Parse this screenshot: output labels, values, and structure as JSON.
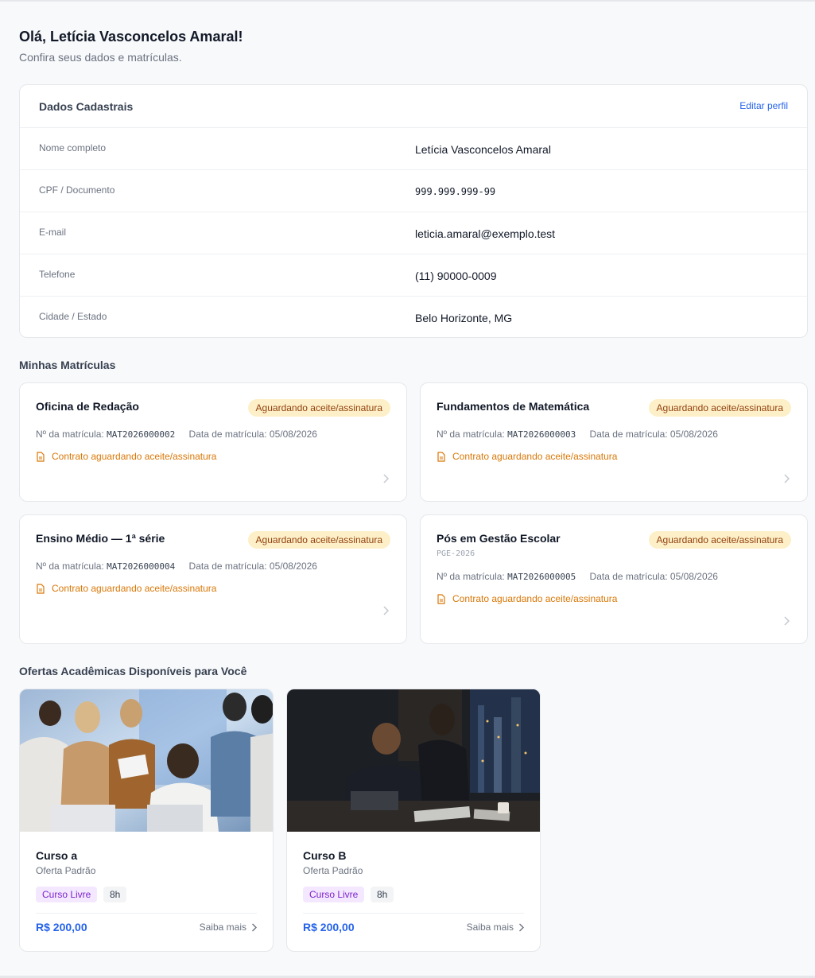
{
  "greeting": "Olá, Letícia Vasconcelos Amaral!",
  "subtitle": "Confira seus dados e matrículas.",
  "profile": {
    "title": "Dados Cadastrais",
    "edit_label": "Editar perfil",
    "fields": [
      {
        "label": "Nome completo",
        "value": "Letícia Vasconcelos Amaral"
      },
      {
        "label": "CPF / Documento",
        "value": "999.999.999-99"
      },
      {
        "label": "E-mail",
        "value": "leticia.amaral@exemplo.test"
      },
      {
        "label": "Telefone",
        "value": "(11) 90000-0009"
      },
      {
        "label": "Cidade / Estado",
        "value": "Belo Horizonte, MG"
      }
    ]
  },
  "enrollments": {
    "title": "Minhas Matrículas",
    "number_label": "Nº da matrícula:",
    "date_label": "Data de matrícula:",
    "items": [
      {
        "name": "Oficina de Redação",
        "code": "",
        "status": "Aguardando aceite/assinatura",
        "number": "MAT2026000002",
        "date": "05/08/2026",
        "contract": "Contrato aguardando aceite/assinatura"
      },
      {
        "name": "Fundamentos de Matemática",
        "code": "",
        "status": "Aguardando aceite/assinatura",
        "number": "MAT2026000003",
        "date": "05/08/2026",
        "contract": "Contrato aguardando aceite/assinatura"
      },
      {
        "name": "Ensino Médio — 1ª série",
        "code": "",
        "status": "Aguardando aceite/assinatura",
        "number": "MAT2026000004",
        "date": "05/08/2026",
        "contract": "Contrato aguardando aceite/assinatura"
      },
      {
        "name": "Pós em Gestão Escolar",
        "code": "PGE-2026",
        "status": "Aguardando aceite/assinatura",
        "number": "MAT2026000005",
        "date": "05/08/2026",
        "contract": "Contrato aguardando aceite/assinatura"
      }
    ]
  },
  "offers": {
    "title": "Ofertas Acadêmicas Disponíveis para Você",
    "more_label": "Saiba mais",
    "items": [
      {
        "name": "Curso a",
        "type": "Oferta Padrão",
        "tag": "Curso Livre",
        "hours": "8h",
        "price": "R$ 200,00"
      },
      {
        "name": "Curso B",
        "type": "Oferta Padrão",
        "tag": "Curso Livre",
        "hours": "8h",
        "price": "R$ 200,00"
      }
    ]
  },
  "colors": {
    "accent": "#2563eb",
    "badge_bg": "#fdf0c8",
    "warning": "#d97706",
    "tag_purple": "#7e22ce"
  }
}
